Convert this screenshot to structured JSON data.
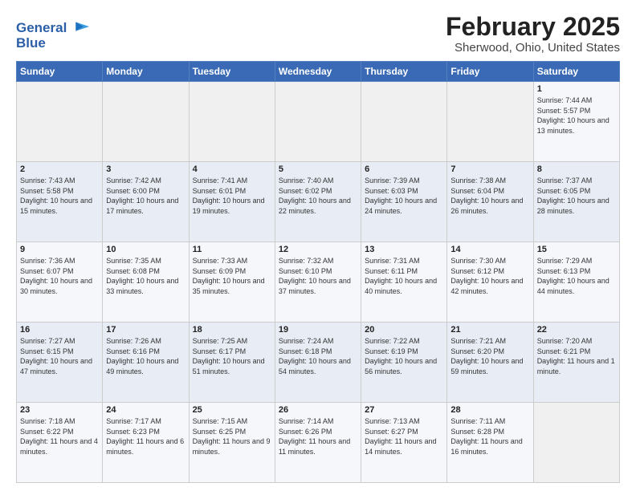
{
  "header": {
    "logo_line1": "General",
    "logo_line2": "Blue",
    "main_title": "February 2025",
    "subtitle": "Sherwood, Ohio, United States"
  },
  "days_of_week": [
    "Sunday",
    "Monday",
    "Tuesday",
    "Wednesday",
    "Thursday",
    "Friday",
    "Saturday"
  ],
  "weeks": [
    [
      {
        "day": "",
        "info": ""
      },
      {
        "day": "",
        "info": ""
      },
      {
        "day": "",
        "info": ""
      },
      {
        "day": "",
        "info": ""
      },
      {
        "day": "",
        "info": ""
      },
      {
        "day": "",
        "info": ""
      },
      {
        "day": "1",
        "info": "Sunrise: 7:44 AM\nSunset: 5:57 PM\nDaylight: 10 hours and 13 minutes."
      }
    ],
    [
      {
        "day": "2",
        "info": "Sunrise: 7:43 AM\nSunset: 5:58 PM\nDaylight: 10 hours and 15 minutes."
      },
      {
        "day": "3",
        "info": "Sunrise: 7:42 AM\nSunset: 6:00 PM\nDaylight: 10 hours and 17 minutes."
      },
      {
        "day": "4",
        "info": "Sunrise: 7:41 AM\nSunset: 6:01 PM\nDaylight: 10 hours and 19 minutes."
      },
      {
        "day": "5",
        "info": "Sunrise: 7:40 AM\nSunset: 6:02 PM\nDaylight: 10 hours and 22 minutes."
      },
      {
        "day": "6",
        "info": "Sunrise: 7:39 AM\nSunset: 6:03 PM\nDaylight: 10 hours and 24 minutes."
      },
      {
        "day": "7",
        "info": "Sunrise: 7:38 AM\nSunset: 6:04 PM\nDaylight: 10 hours and 26 minutes."
      },
      {
        "day": "8",
        "info": "Sunrise: 7:37 AM\nSunset: 6:05 PM\nDaylight: 10 hours and 28 minutes."
      }
    ],
    [
      {
        "day": "9",
        "info": "Sunrise: 7:36 AM\nSunset: 6:07 PM\nDaylight: 10 hours and 30 minutes."
      },
      {
        "day": "10",
        "info": "Sunrise: 7:35 AM\nSunset: 6:08 PM\nDaylight: 10 hours and 33 minutes."
      },
      {
        "day": "11",
        "info": "Sunrise: 7:33 AM\nSunset: 6:09 PM\nDaylight: 10 hours and 35 minutes."
      },
      {
        "day": "12",
        "info": "Sunrise: 7:32 AM\nSunset: 6:10 PM\nDaylight: 10 hours and 37 minutes."
      },
      {
        "day": "13",
        "info": "Sunrise: 7:31 AM\nSunset: 6:11 PM\nDaylight: 10 hours and 40 minutes."
      },
      {
        "day": "14",
        "info": "Sunrise: 7:30 AM\nSunset: 6:12 PM\nDaylight: 10 hours and 42 minutes."
      },
      {
        "day": "15",
        "info": "Sunrise: 7:29 AM\nSunset: 6:13 PM\nDaylight: 10 hours and 44 minutes."
      }
    ],
    [
      {
        "day": "16",
        "info": "Sunrise: 7:27 AM\nSunset: 6:15 PM\nDaylight: 10 hours and 47 minutes."
      },
      {
        "day": "17",
        "info": "Sunrise: 7:26 AM\nSunset: 6:16 PM\nDaylight: 10 hours and 49 minutes."
      },
      {
        "day": "18",
        "info": "Sunrise: 7:25 AM\nSunset: 6:17 PM\nDaylight: 10 hours and 51 minutes."
      },
      {
        "day": "19",
        "info": "Sunrise: 7:24 AM\nSunset: 6:18 PM\nDaylight: 10 hours and 54 minutes."
      },
      {
        "day": "20",
        "info": "Sunrise: 7:22 AM\nSunset: 6:19 PM\nDaylight: 10 hours and 56 minutes."
      },
      {
        "day": "21",
        "info": "Sunrise: 7:21 AM\nSunset: 6:20 PM\nDaylight: 10 hours and 59 minutes."
      },
      {
        "day": "22",
        "info": "Sunrise: 7:20 AM\nSunset: 6:21 PM\nDaylight: 11 hours and 1 minute."
      }
    ],
    [
      {
        "day": "23",
        "info": "Sunrise: 7:18 AM\nSunset: 6:22 PM\nDaylight: 11 hours and 4 minutes."
      },
      {
        "day": "24",
        "info": "Sunrise: 7:17 AM\nSunset: 6:23 PM\nDaylight: 11 hours and 6 minutes."
      },
      {
        "day": "25",
        "info": "Sunrise: 7:15 AM\nSunset: 6:25 PM\nDaylight: 11 hours and 9 minutes."
      },
      {
        "day": "26",
        "info": "Sunrise: 7:14 AM\nSunset: 6:26 PM\nDaylight: 11 hours and 11 minutes."
      },
      {
        "day": "27",
        "info": "Sunrise: 7:13 AM\nSunset: 6:27 PM\nDaylight: 11 hours and 14 minutes."
      },
      {
        "day": "28",
        "info": "Sunrise: 7:11 AM\nSunset: 6:28 PM\nDaylight: 11 hours and 16 minutes."
      },
      {
        "day": "",
        "info": ""
      }
    ]
  ]
}
